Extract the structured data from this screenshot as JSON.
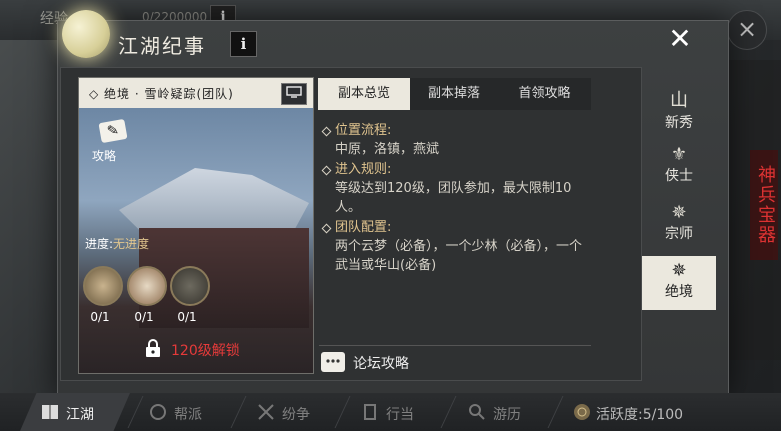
{
  "top": {
    "exp_label": "经验",
    "exp_value": "0/2200000",
    "info": "i"
  },
  "outer_close": "×",
  "side_banner": "神兵宝器",
  "panel": {
    "title": "江湖纪事",
    "info": "i",
    "close": "✕"
  },
  "card": {
    "title": "◇ 绝境 · 雪岭疑踪(团队)",
    "screen_icon": "screen-icon",
    "guide": "攻略",
    "progress_label": "进度:",
    "progress_value": "无进度",
    "bosses": [
      {
        "count": "0/1"
      },
      {
        "count": "0/1"
      },
      {
        "count": "0/1"
      }
    ],
    "unlock": "120级解锁"
  },
  "tabs": [
    {
      "label": "副本总览",
      "active": true
    },
    {
      "label": "副本掉落",
      "active": false
    },
    {
      "label": "首领攻略",
      "active": false
    }
  ],
  "sections": [
    {
      "head": "位置流程:",
      "body": "中原，洛镇，燕斌"
    },
    {
      "head": "进入规则:",
      "body": "等级达到120级，团队参加，最大限制10人。"
    },
    {
      "head": "团队配置:",
      "body": "两个云梦（必备），一个少林（必备），一个武当或华山(必备)"
    }
  ],
  "forum": "论坛攻略",
  "side_tabs": [
    {
      "label": "新秀",
      "glyph": "山",
      "active": false
    },
    {
      "label": "侠士",
      "glyph": "⚜",
      "active": false
    },
    {
      "label": "宗师",
      "glyph": "✵",
      "active": false
    },
    {
      "label": "绝境",
      "glyph": "✵",
      "active": true
    }
  ],
  "bottom": [
    {
      "label": "江湖",
      "active": true
    },
    {
      "label": "帮派",
      "active": false
    },
    {
      "label": "纷争",
      "active": false
    },
    {
      "label": "行当",
      "active": false
    },
    {
      "label": "游历",
      "active": false
    },
    {
      "label": "活跃度:5/100",
      "active": false
    }
  ]
}
